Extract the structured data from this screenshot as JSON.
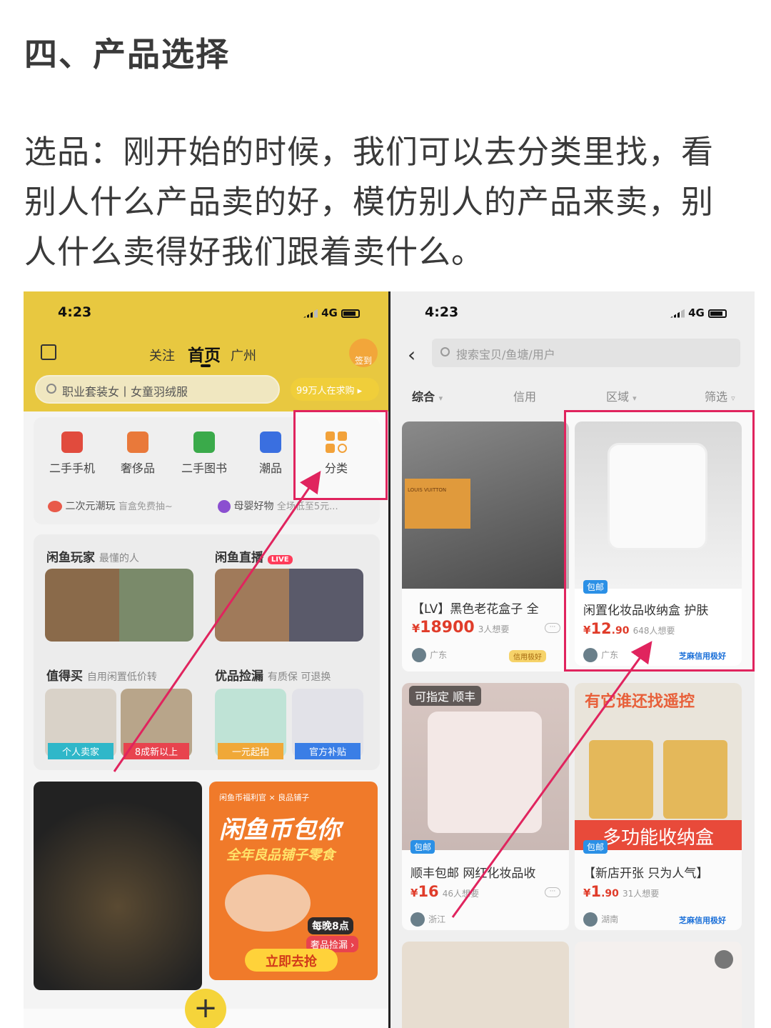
{
  "heading": "四、产品选择",
  "paragraph": "选品：刚开始的时候，我们可以去分类里找，看别人什么产品卖的好，模仿别人的产品来卖，别人什么卖得好我们跟着卖什么。",
  "left": {
    "status": {
      "time": "4:23",
      "network": "4G"
    },
    "header": {
      "follow": "关注",
      "home": "首页",
      "city": "广州",
      "sign": "签到"
    },
    "search": {
      "placeholder": "职业套装女丨女童羽绒服",
      "promo": "99万人在求购 ▸"
    },
    "categories": [
      {
        "label": "二手手机",
        "color": "#e14b3d"
      },
      {
        "label": "奢侈品",
        "color": "#e9793a"
      },
      {
        "label": "二手图书",
        "color": "#3aaa4a"
      },
      {
        "label": "潮品",
        "color": "#3a6fe0"
      },
      {
        "label": "分类",
        "color": "#f2a23a"
      }
    ],
    "subrow": {
      "item1": "二次元潮玩",
      "item1_sub": "盲盒免费抽~",
      "item2": "母婴好物",
      "item2_sub": "全场低至5元..."
    },
    "cards": {
      "players": {
        "title": "闲鱼玩家",
        "sub": "最懂的人"
      },
      "live": {
        "title": "闲鱼直播",
        "live_badge": "LIVE"
      },
      "worth": {
        "title": "值得买",
        "sub": "自用闲置低价转",
        "tag1": "个人卖家",
        "tag2": "8成新以上"
      },
      "picks": {
        "title": "优品捡漏",
        "sub": "有质保 可退换",
        "tag1": "一元起拍",
        "tag2": "官方补贴"
      }
    },
    "banner": {
      "top": "闲鱼币福利官 × 良品铺子",
      "big": "闲鱼币包你",
      "sub": "全年良品铺子零食",
      "night": "每晚8点",
      "lux": "奢品捡漏 ›",
      "go": "立即去抢"
    },
    "tabbar": {
      "plus": "+"
    }
  },
  "right": {
    "status": {
      "time": "4:23",
      "network": "4G"
    },
    "search": {
      "placeholder": "搜索宝贝/鱼塘/用户"
    },
    "filters": [
      "综合",
      "信用",
      "区域",
      "筛选"
    ],
    "products": [
      {
        "title": "【LV】黑色老花盒子 全",
        "price": "18900",
        "want": "3人想要",
        "loc": "广东",
        "badge": "",
        "credit": "信用极好",
        "brand": "LOUIS VUITTON"
      },
      {
        "title": "闲置化妆品收纳盒 护肤",
        "price": "12",
        "price_dec": ".90",
        "want": "648人想要",
        "loc": "广东",
        "badge": "包邮",
        "credit": "芝麻信用极好"
      },
      {
        "title": "顺丰包邮 网红化妆品收",
        "price": "16",
        "want": "46人想要",
        "loc": "浙江",
        "badge": "包邮",
        "overlay": "可指定 顺丰"
      },
      {
        "title": "【新店开张 只为人气】",
        "price": "1",
        "price_dec": ".90",
        "want": "31人想要",
        "loc": "湖南",
        "badge": "包邮",
        "credit": "芝麻信用极好",
        "top_text": "有它谁还找遥控",
        "bottom_text": "多功能收纳盒"
      }
    ],
    "currency": "¥"
  },
  "colors": {
    "highlight": "#e0245e",
    "price": "#e03c2a",
    "xianyu_yellow": "#e8c840"
  }
}
